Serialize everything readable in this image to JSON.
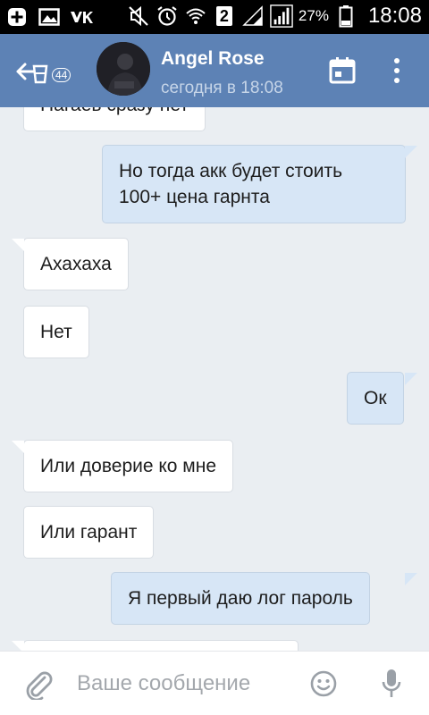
{
  "status_bar": {
    "battery_percent": "27%",
    "time": "18:08",
    "sim": "2",
    "icons_left": [
      "add-box-icon",
      "image-icon",
      "vk-icon"
    ],
    "icons_right": [
      "mute-icon",
      "alarm-icon",
      "wifi-icon",
      "sim-2-icon",
      "signal-icon",
      "signal-icon",
      "battery-icon"
    ]
  },
  "header": {
    "back_badge": "44",
    "title": "Angel Rose",
    "subtitle": "сегодня в 18:08",
    "accent_color": "#5d82b5"
  },
  "messages": [
    {
      "direction": "in",
      "text": "Нагаев сразу нет"
    },
    {
      "direction": "out",
      "text": "Но тогда акк будет стоить"
    },
    {
      "direction": "out",
      "text": "100+ цена гарнта"
    },
    {
      "direction": "in",
      "text": "Ахахаха"
    },
    {
      "direction": "in",
      "text": "Нет"
    },
    {
      "direction": "out",
      "text": "Ок"
    },
    {
      "direction": "in",
      "text": "Или доверие ко мне"
    },
    {
      "direction": "in",
      "text": "Или гарант"
    },
    {
      "direction": "out",
      "text": "Я первый даю лог пароль"
    }
  ],
  "composer": {
    "placeholder": "Ваше сообщение"
  }
}
